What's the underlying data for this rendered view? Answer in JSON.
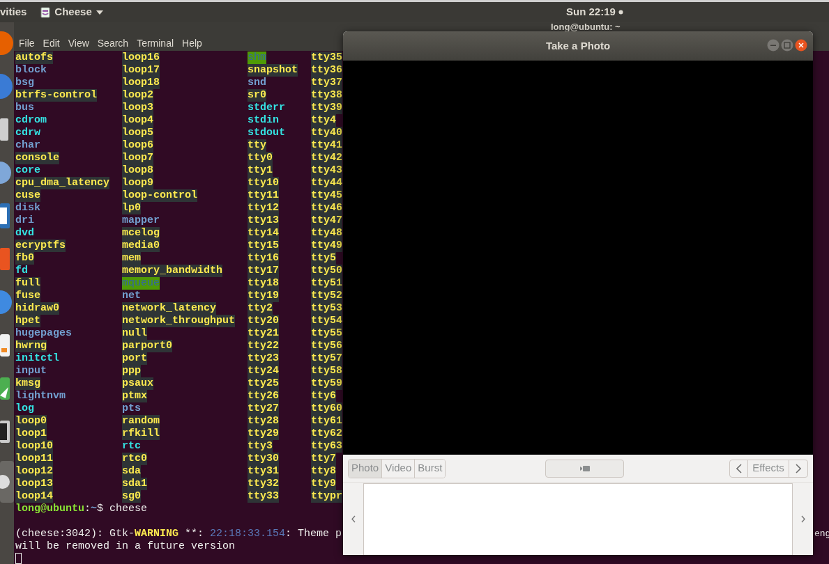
{
  "top_bar": {
    "activities": "vities",
    "app_menu": "Cheese",
    "clock": "Sun 22:19"
  },
  "terminal": {
    "title": "long@ubuntu: ~",
    "menu": [
      "File",
      "Edit",
      "View",
      "Search",
      "Terminal",
      "Help"
    ],
    "columns": [
      [
        {
          "name": "autofs",
          "kind": "device"
        },
        {
          "name": "block",
          "kind": "dir"
        },
        {
          "name": "bsg",
          "kind": "dir"
        },
        {
          "name": "btrfs-control",
          "kind": "device"
        },
        {
          "name": "bus",
          "kind": "dir"
        },
        {
          "name": "cdrom",
          "kind": "link"
        },
        {
          "name": "cdrw",
          "kind": "link"
        },
        {
          "name": "char",
          "kind": "dir"
        },
        {
          "name": "console",
          "kind": "device"
        },
        {
          "name": "core",
          "kind": "link"
        },
        {
          "name": "cpu_dma_latency",
          "kind": "device"
        },
        {
          "name": "cuse",
          "kind": "device"
        },
        {
          "name": "disk",
          "kind": "dir"
        },
        {
          "name": "dri",
          "kind": "dir"
        },
        {
          "name": "dvd",
          "kind": "link"
        },
        {
          "name": "ecryptfs",
          "kind": "device"
        },
        {
          "name": "fb0",
          "kind": "device"
        },
        {
          "name": "fd",
          "kind": "link"
        },
        {
          "name": "full",
          "kind": "device"
        },
        {
          "name": "fuse",
          "kind": "device"
        },
        {
          "name": "hidraw0",
          "kind": "device"
        },
        {
          "name": "hpet",
          "kind": "device"
        },
        {
          "name": "hugepages",
          "kind": "dir"
        },
        {
          "name": "hwrng",
          "kind": "device"
        },
        {
          "name": "initctl",
          "kind": "link"
        },
        {
          "name": "input",
          "kind": "dir"
        },
        {
          "name": "kmsg",
          "kind": "device"
        },
        {
          "name": "lightnvm",
          "kind": "dir"
        },
        {
          "name": "log",
          "kind": "link"
        },
        {
          "name": "loop0",
          "kind": "device"
        },
        {
          "name": "loop1",
          "kind": "device"
        },
        {
          "name": "loop10",
          "kind": "device"
        },
        {
          "name": "loop11",
          "kind": "device"
        },
        {
          "name": "loop12",
          "kind": "device"
        },
        {
          "name": "loop13",
          "kind": "device"
        },
        {
          "name": "loop14",
          "kind": "device"
        }
      ],
      [
        {
          "name": "loop16",
          "kind": "device"
        },
        {
          "name": "loop17",
          "kind": "device"
        },
        {
          "name": "loop18",
          "kind": "device"
        },
        {
          "name": "loop2",
          "kind": "device"
        },
        {
          "name": "loop3",
          "kind": "device"
        },
        {
          "name": "loop4",
          "kind": "device"
        },
        {
          "name": "loop5",
          "kind": "device"
        },
        {
          "name": "loop6",
          "kind": "device"
        },
        {
          "name": "loop7",
          "kind": "device"
        },
        {
          "name": "loop8",
          "kind": "device"
        },
        {
          "name": "loop9",
          "kind": "device"
        },
        {
          "name": "loop-control",
          "kind": "device"
        },
        {
          "name": "lp0",
          "kind": "device"
        },
        {
          "name": "mapper",
          "kind": "dir"
        },
        {
          "name": "mcelog",
          "kind": "device"
        },
        {
          "name": "media0",
          "kind": "device"
        },
        {
          "name": "mem",
          "kind": "device"
        },
        {
          "name": "memory_bandwidth",
          "kind": "device"
        },
        {
          "name": "mqueue",
          "kind": "sticky"
        },
        {
          "name": "net",
          "kind": "dir"
        },
        {
          "name": "network_latency",
          "kind": "device"
        },
        {
          "name": "network_throughput",
          "kind": "device"
        },
        {
          "name": "null",
          "kind": "device"
        },
        {
          "name": "parport0",
          "kind": "device"
        },
        {
          "name": "port",
          "kind": "device"
        },
        {
          "name": "ppp",
          "kind": "device"
        },
        {
          "name": "psaux",
          "kind": "device"
        },
        {
          "name": "ptmx",
          "kind": "device"
        },
        {
          "name": "pts",
          "kind": "dir"
        },
        {
          "name": "random",
          "kind": "device"
        },
        {
          "name": "rfkill",
          "kind": "device"
        },
        {
          "name": "rtc",
          "kind": "link"
        },
        {
          "name": "rtc0",
          "kind": "device"
        },
        {
          "name": "sda",
          "kind": "device"
        },
        {
          "name": "sda1",
          "kind": "device"
        },
        {
          "name": "sg0",
          "kind": "device"
        }
      ],
      [
        {
          "name": "shm",
          "kind": "sticky"
        },
        {
          "name": "snapshot",
          "kind": "device"
        },
        {
          "name": "snd",
          "kind": "dir"
        },
        {
          "name": "sr0",
          "kind": "device"
        },
        {
          "name": "stderr",
          "kind": "link"
        },
        {
          "name": "stdin",
          "kind": "link"
        },
        {
          "name": "stdout",
          "kind": "link"
        },
        {
          "name": "tty",
          "kind": "device"
        },
        {
          "name": "tty0",
          "kind": "device"
        },
        {
          "name": "tty1",
          "kind": "device"
        },
        {
          "name": "tty10",
          "kind": "device"
        },
        {
          "name": "tty11",
          "kind": "device"
        },
        {
          "name": "tty12",
          "kind": "device"
        },
        {
          "name": "tty13",
          "kind": "device"
        },
        {
          "name": "tty14",
          "kind": "device"
        },
        {
          "name": "tty15",
          "kind": "device"
        },
        {
          "name": "tty16",
          "kind": "device"
        },
        {
          "name": "tty17",
          "kind": "device"
        },
        {
          "name": "tty18",
          "kind": "device"
        },
        {
          "name": "tty19",
          "kind": "device"
        },
        {
          "name": "tty2",
          "kind": "device"
        },
        {
          "name": "tty20",
          "kind": "device"
        },
        {
          "name": "tty21",
          "kind": "device"
        },
        {
          "name": "tty22",
          "kind": "device"
        },
        {
          "name": "tty23",
          "kind": "device"
        },
        {
          "name": "tty24",
          "kind": "device"
        },
        {
          "name": "tty25",
          "kind": "device"
        },
        {
          "name": "tty26",
          "kind": "device"
        },
        {
          "name": "tty27",
          "kind": "device"
        },
        {
          "name": "tty28",
          "kind": "device"
        },
        {
          "name": "tty29",
          "kind": "device"
        },
        {
          "name": "tty3",
          "kind": "device"
        },
        {
          "name": "tty30",
          "kind": "device"
        },
        {
          "name": "tty31",
          "kind": "device"
        },
        {
          "name": "tty32",
          "kind": "device"
        },
        {
          "name": "tty33",
          "kind": "device"
        }
      ],
      [
        {
          "name": "tty35",
          "kind": "device"
        },
        {
          "name": "tty36",
          "kind": "device"
        },
        {
          "name": "tty37",
          "kind": "device"
        },
        {
          "name": "tty38",
          "kind": "device"
        },
        {
          "name": "tty39",
          "kind": "device"
        },
        {
          "name": "tty4",
          "kind": "device"
        },
        {
          "name": "tty40",
          "kind": "device"
        },
        {
          "name": "tty41",
          "kind": "device"
        },
        {
          "name": "tty42",
          "kind": "device"
        },
        {
          "name": "tty43",
          "kind": "device"
        },
        {
          "name": "tty44",
          "kind": "device"
        },
        {
          "name": "tty45",
          "kind": "device"
        },
        {
          "name": "tty46",
          "kind": "device"
        },
        {
          "name": "tty47",
          "kind": "device"
        },
        {
          "name": "tty48",
          "kind": "device"
        },
        {
          "name": "tty49",
          "kind": "device"
        },
        {
          "name": "tty5",
          "kind": "device"
        },
        {
          "name": "tty50",
          "kind": "device"
        },
        {
          "name": "tty51",
          "kind": "device"
        },
        {
          "name": "tty52",
          "kind": "device"
        },
        {
          "name": "tty53",
          "kind": "device"
        },
        {
          "name": "tty54",
          "kind": "device"
        },
        {
          "name": "tty55",
          "kind": "device"
        },
        {
          "name": "tty56",
          "kind": "device"
        },
        {
          "name": "tty57",
          "kind": "device"
        },
        {
          "name": "tty58",
          "kind": "device"
        },
        {
          "name": "tty59",
          "kind": "device"
        },
        {
          "name": "tty6",
          "kind": "device"
        },
        {
          "name": "tty60",
          "kind": "device"
        },
        {
          "name": "tty61",
          "kind": "device"
        },
        {
          "name": "tty62",
          "kind": "device"
        },
        {
          "name": "tty63",
          "kind": "device"
        },
        {
          "name": "tty7",
          "kind": "device"
        },
        {
          "name": "tty8",
          "kind": "device"
        },
        {
          "name": "tty9",
          "kind": "device"
        },
        {
          "name": "ttypr",
          "kind": "device"
        }
      ]
    ],
    "prompt": [
      {
        "text": "long@ubuntu",
        "kind": "user"
      },
      {
        "text": ":",
        "kind": "plain"
      },
      {
        "text": "~",
        "kind": "path"
      },
      {
        "text": "$ cheese",
        "kind": "plain"
      }
    ],
    "warning": [
      {
        "text": "(cheese:3042): Gtk-",
        "kind": "plain"
      },
      {
        "text": "WARNING",
        "kind": "warning"
      },
      {
        "text": " **: ",
        "kind": "plain"
      },
      {
        "text": "22:18:33.154",
        "kind": "time"
      },
      {
        "text": ": Theme p",
        "kind": "plain"
      }
    ],
    "warning_tail": "eng",
    "warning_line2": "will be removed in a future version"
  },
  "cheese": {
    "title": "Take a Photo",
    "modes": [
      {
        "label": "Photo",
        "selected": true
      },
      {
        "label": "Video",
        "selected": false
      },
      {
        "label": "Burst",
        "selected": false
      }
    ],
    "effects": "Effects"
  }
}
